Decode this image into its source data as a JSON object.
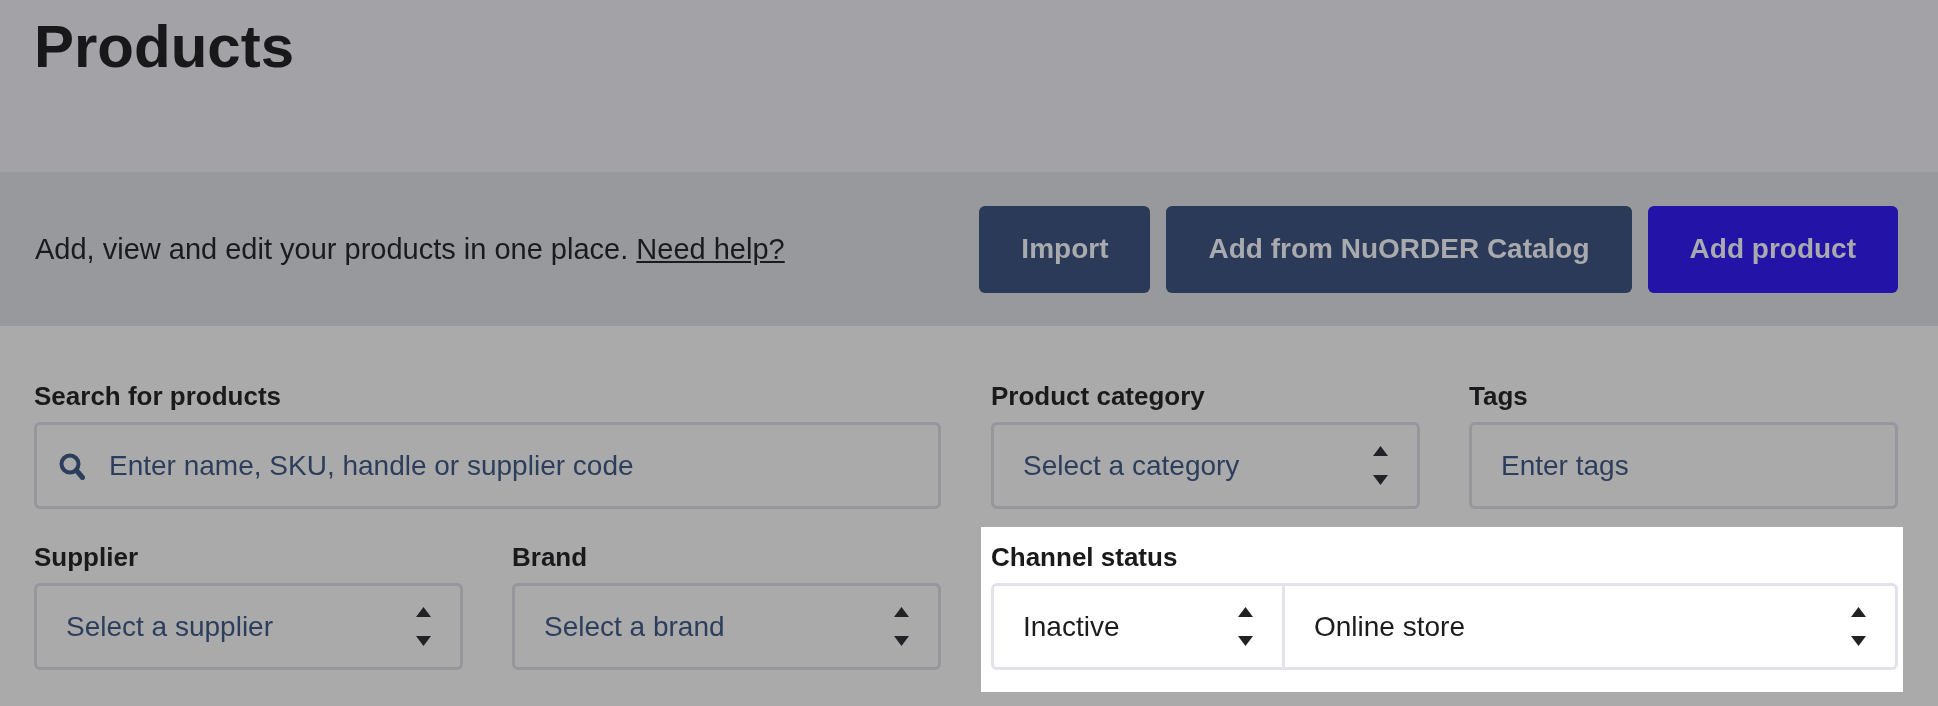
{
  "header": {
    "title": "Products"
  },
  "intro": {
    "text": "Add, view and edit your products in one place.",
    "link": "Need help?"
  },
  "actions": [
    {
      "label": "Import",
      "kind": "secondary"
    },
    {
      "label": "Add from NuORDER Catalog",
      "kind": "secondary"
    },
    {
      "label": "Add product",
      "kind": "primary"
    }
  ],
  "filters": {
    "search": {
      "label": "Search for products",
      "placeholder": "Enter name, SKU, handle or supplier code"
    },
    "category": {
      "label": "Product category",
      "placeholder": "Select a category"
    },
    "tags": {
      "label": "Tags",
      "placeholder": "Enter tags"
    },
    "supplier": {
      "label": "Supplier",
      "placeholder": "Select a supplier"
    },
    "brand": {
      "label": "Brand",
      "placeholder": "Select a brand"
    },
    "channel_status": {
      "label": "Channel status",
      "highlighted": true,
      "status": {
        "value": "Inactive"
      },
      "channel": {
        "value": "Online store"
      }
    }
  }
}
